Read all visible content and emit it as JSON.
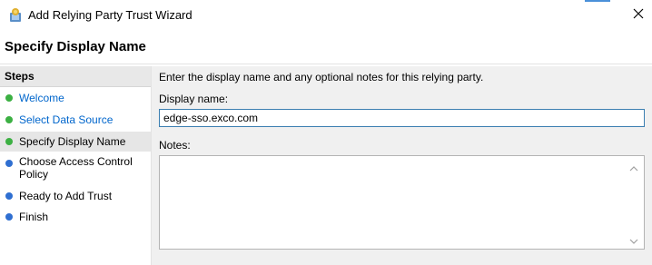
{
  "window": {
    "title": "Add Relying Party Trust Wizard",
    "close_icon": "close-icon",
    "app_icon": "adfs-wizard-icon"
  },
  "header": {
    "page_title": "Specify Display Name"
  },
  "steps": {
    "header": "Steps",
    "items": [
      {
        "label": "Welcome",
        "status": "completed",
        "is_link": true,
        "dot_color": "#3cb043"
      },
      {
        "label": "Select Data Source",
        "status": "completed",
        "is_link": true,
        "dot_color": "#3cb043"
      },
      {
        "label": "Specify Display Name",
        "status": "current",
        "is_link": false,
        "dot_color": "#3cb043"
      },
      {
        "label": "Choose Access Control Policy",
        "status": "pending",
        "is_link": false,
        "dot_color": "#2f6fd1"
      },
      {
        "label": "Ready to Add Trust",
        "status": "pending",
        "is_link": false,
        "dot_color": "#2f6fd1"
      },
      {
        "label": "Finish",
        "status": "pending",
        "is_link": false,
        "dot_color": "#2f6fd1"
      }
    ]
  },
  "main": {
    "instruction": "Enter the display name and any optional notes for this relying party.",
    "display_name_label": "Display name:",
    "display_name_value": "edge-sso.exco.com",
    "notes_label": "Notes:",
    "notes_value": ""
  },
  "colors": {
    "accent": "#4a90d9",
    "completed": "#3cb043",
    "pending": "#2f6fd1",
    "link": "#0066cc",
    "panel_bg": "#f0f0f0"
  }
}
